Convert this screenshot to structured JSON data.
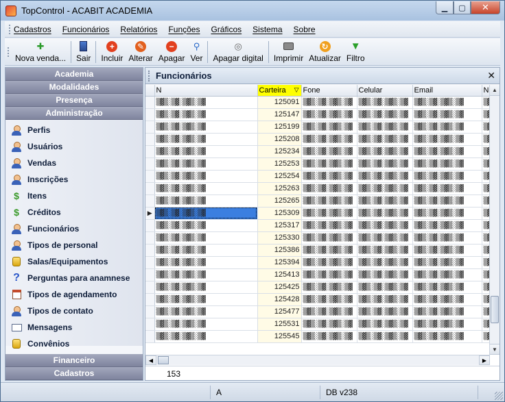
{
  "window": {
    "title": "TopControl - ACABIT ACADEMIA"
  },
  "menu": [
    "Cadastros",
    "Funcionários",
    "Relatórios",
    "Funções",
    "Gráficos",
    "Sistema",
    "Sobre"
  ],
  "toolbar": {
    "nova_venda": "Nova venda...",
    "sair": "Sair",
    "incluir": "Incluir",
    "alterar": "Alterar",
    "apagar": "Apagar",
    "ver": "Ver",
    "apagar_digital": "Apagar digital",
    "imprimir": "Imprimir",
    "atualizar": "Atualizar",
    "filtro": "Filtro"
  },
  "sidebar": {
    "headers_top": [
      "Academia",
      "Modalidades",
      "Presença",
      "Administração"
    ],
    "items": [
      {
        "label": "Perfis",
        "icon": "user-group-icon"
      },
      {
        "label": "Usuários",
        "icon": "user-icon"
      },
      {
        "label": "Vendas",
        "icon": "sales-icon"
      },
      {
        "label": "Inscrições",
        "icon": "registration-icon"
      },
      {
        "label": "Itens",
        "icon": "dollar-icon"
      },
      {
        "label": "Créditos",
        "icon": "dollar-icon"
      },
      {
        "label": "Funcionários",
        "icon": "employee-icon"
      },
      {
        "label": "Tipos de personal",
        "icon": "personal-icon"
      },
      {
        "label": "Salas/Equipamentos",
        "icon": "coin-icon"
      },
      {
        "label": "Perguntas para anamnese",
        "icon": "question-icon"
      },
      {
        "label": "Tipos de agendamento",
        "icon": "calendar-icon"
      },
      {
        "label": "Tipos de contato",
        "icon": "contact-icon"
      },
      {
        "label": "Mensagens",
        "icon": "mail-icon"
      },
      {
        "label": "Convênios",
        "icon": "coin-icon"
      }
    ],
    "headers_bottom": [
      "Financeiro",
      "Cadastros"
    ]
  },
  "panel": {
    "title": "Funcionários",
    "count": "153"
  },
  "grid": {
    "columns": [
      "N",
      "Carteira",
      "Fone",
      "Celular",
      "Email",
      "Na"
    ],
    "rows": [
      {
        "carteira": "125091"
      },
      {
        "carteira": "125147"
      },
      {
        "carteira": "125199"
      },
      {
        "carteira": "125208"
      },
      {
        "carteira": "125234"
      },
      {
        "carteira": "125253"
      },
      {
        "carteira": "125254"
      },
      {
        "carteira": "125263"
      },
      {
        "carteira": "125265"
      },
      {
        "carteira": "125309",
        "selected": true
      },
      {
        "carteira": "125317"
      },
      {
        "carteira": "125330"
      },
      {
        "carteira": "125386"
      },
      {
        "carteira": "125394"
      },
      {
        "carteira": "125413"
      },
      {
        "carteira": "125425"
      },
      {
        "carteira": "125428"
      },
      {
        "carteira": "125477"
      },
      {
        "carteira": "125531"
      },
      {
        "carteira": "125545"
      }
    ]
  },
  "status": {
    "cell2": "A",
    "cell3": "DB v238"
  },
  "colors": {
    "sidebar_header": "#8a8fa8",
    "selection": "#3b7fe0",
    "sorted_header": "#ffff00"
  }
}
